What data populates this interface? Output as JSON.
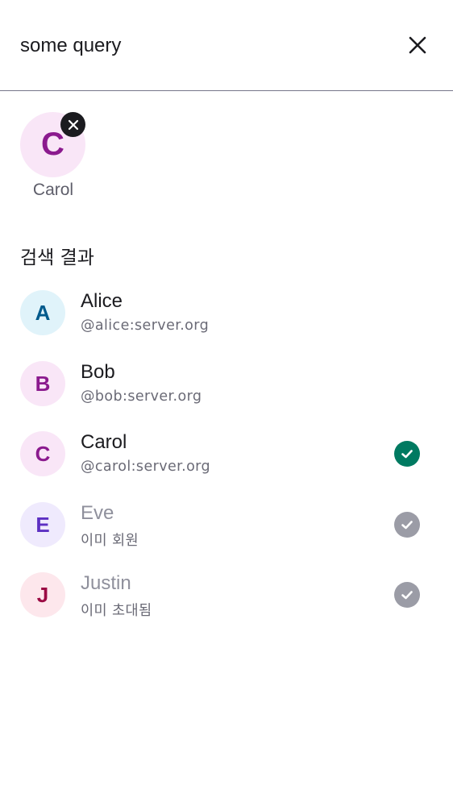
{
  "search": {
    "value": "some query",
    "close_icon": "close-icon"
  },
  "selected_users": [
    {
      "initial": "C",
      "name": "Carol",
      "avatar_bg": "#f9e6f7",
      "avatar_fg": "#8b1a8e"
    }
  ],
  "results": {
    "title": "검색 결과",
    "items": [
      {
        "initial": "A",
        "name": "Alice",
        "subtitle": "@alice:server.org",
        "state": "none",
        "avatar_bg": "#e0f3fa",
        "avatar_fg": "#005a8c"
      },
      {
        "initial": "B",
        "name": "Bob",
        "subtitle": "@bob:server.org",
        "state": "none",
        "avatar_bg": "#f9e6f7",
        "avatar_fg": "#8b1a8e"
      },
      {
        "initial": "C",
        "name": "Carol",
        "subtitle": "@carol:server.org",
        "state": "selected",
        "avatar_bg": "#f9e6f7",
        "avatar_fg": "#8b1a8e"
      },
      {
        "initial": "E",
        "name": "Eve",
        "subtitle": "이미 회원",
        "state": "disabled",
        "avatar_bg": "#efeafd",
        "avatar_fg": "#5c2fc2"
      },
      {
        "initial": "J",
        "name": "Justin",
        "subtitle": "이미 초대됨",
        "state": "disabled",
        "avatar_bg": "#fde7ec",
        "avatar_fg": "#9b0c44"
      }
    ]
  },
  "colors": {
    "selected_check": "#007a61",
    "disabled_check": "#9b9ca6"
  }
}
